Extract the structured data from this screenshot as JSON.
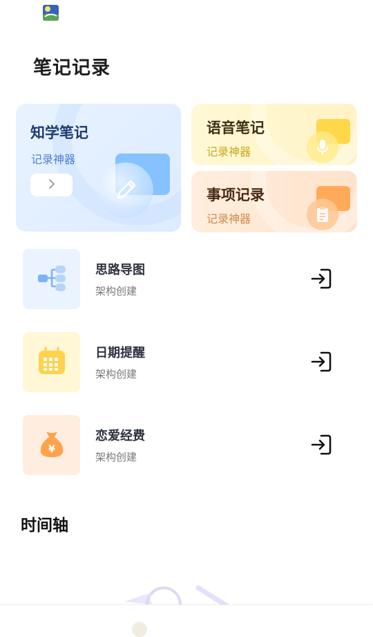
{
  "app": {
    "icon": "app-logo-icon"
  },
  "page_title": "笔记记录",
  "cards": {
    "main": {
      "title": "知学笔记",
      "subtitle": "记录神器",
      "button_icon": "chevron-right-icon",
      "icon": "pencil-icon"
    },
    "voice": {
      "title": "语音笔记",
      "subtitle": "记录神器",
      "icon": "microphone-icon"
    },
    "task": {
      "title": "事项记录",
      "subtitle": "记录神器",
      "icon": "clipboard-icon"
    }
  },
  "list": [
    {
      "name": "思路导图",
      "desc": "架构创建",
      "icon": "mindmap-icon",
      "tile_color": "#eaf3ff",
      "action_icon": "enter-icon"
    },
    {
      "name": "日期提醒",
      "desc": "架构创建",
      "icon": "calendar-icon",
      "tile_color": "#fff7d6",
      "action_icon": "enter-icon"
    },
    {
      "name": "恋爱经费",
      "desc": "架构创建",
      "icon": "money-bag-icon",
      "tile_color": "#ffeee0",
      "action_icon": "enter-icon"
    }
  ],
  "timeline": {
    "title": "时间轴"
  }
}
